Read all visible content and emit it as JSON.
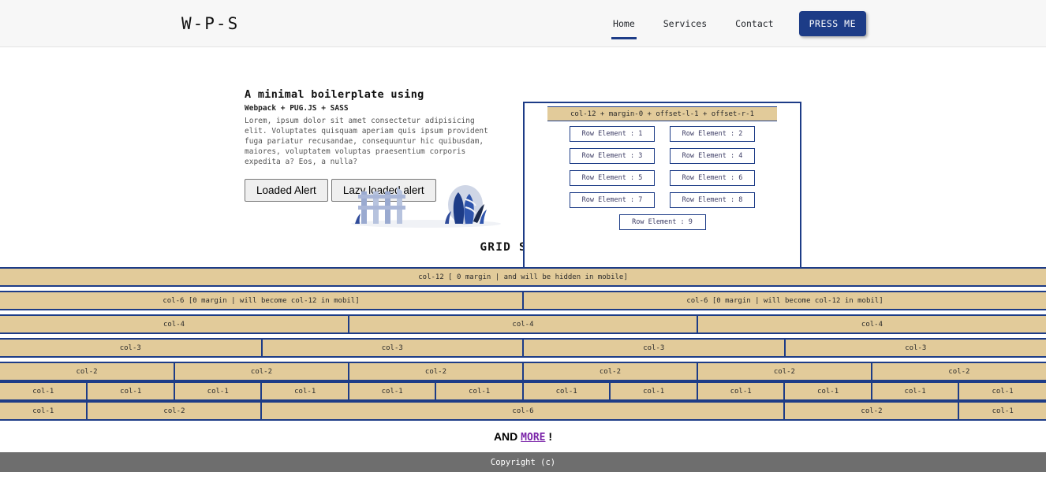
{
  "header": {
    "brand": "W-P-S",
    "nav": [
      {
        "label": "Home",
        "active": true
      },
      {
        "label": "Services",
        "active": false
      },
      {
        "label": "Contact",
        "active": false
      }
    ],
    "cta_label": "PRESS ME"
  },
  "hero": {
    "title": "A minimal boilerplate using",
    "subtitle": "Webpack + PUG.JS + SASS",
    "body": "Lorem, ipsum dolor sit amet consectetur adipisicing elit. Voluptates quisquam aperiam quis ipsum provident fuga pariatur recusandae, consequuntur hic quibusdam, maiores, voluptatem voluptas praesentium corporis expedita a? Eos, a nulla?",
    "button_primary": "Loaded Alert",
    "button_secondary": "Lazy loaded alert"
  },
  "panel": {
    "header_label": "col-12 + margin-0 + offset-l-1 + offset-r-1",
    "rows": [
      [
        "Row Element : 1",
        "Row Element : 2"
      ],
      [
        "Row Element : 3",
        "Row Element : 4"
      ],
      [
        "Row Element : 5",
        "Row Element : 6"
      ],
      [
        "Row Element : 7",
        "Row Element : 8"
      ]
    ],
    "last_row": "Row Element : 9"
  },
  "grid": {
    "heading": "GRID SYSTEM",
    "rows": [
      {
        "cells": [
          {
            "span": 12,
            "label": "col-12 [ 0 margin | and will be hidden in mobile]"
          }
        ]
      },
      {
        "cells": [
          {
            "span": 6,
            "label": "col-6 [0 margin | will become col-12 in mobil]"
          },
          {
            "span": 6,
            "label": "col-6 [0 margin | will become col-12 in mobil]"
          }
        ]
      },
      {
        "cells": [
          {
            "span": 4,
            "label": "col-4"
          },
          {
            "span": 4,
            "label": "col-4"
          },
          {
            "span": 4,
            "label": "col-4"
          }
        ]
      },
      {
        "cells": [
          {
            "span": 3,
            "label": "col-3"
          },
          {
            "span": 3,
            "label": "col-3"
          },
          {
            "span": 3,
            "label": "col-3"
          },
          {
            "span": 3,
            "label": "col-3"
          }
        ]
      },
      {
        "cells": [
          {
            "span": 2,
            "label": "col-2"
          },
          {
            "span": 2,
            "label": "col-2"
          },
          {
            "span": 2,
            "label": "col-2"
          },
          {
            "span": 2,
            "label": "col-2"
          },
          {
            "span": 2,
            "label": "col-2"
          },
          {
            "span": 2,
            "label": "col-2"
          }
        ]
      },
      {
        "cells": [
          {
            "span": 1,
            "label": "col-1"
          },
          {
            "span": 1,
            "label": "col-1"
          },
          {
            "span": 1,
            "label": "col-1"
          },
          {
            "span": 1,
            "label": "col-1"
          },
          {
            "span": 1,
            "label": "col-1"
          },
          {
            "span": 1,
            "label": "col-1"
          },
          {
            "span": 1,
            "label": "col-1"
          },
          {
            "span": 1,
            "label": "col-1"
          },
          {
            "span": 1,
            "label": "col-1"
          },
          {
            "span": 1,
            "label": "col-1"
          },
          {
            "span": 1,
            "label": "col-1"
          },
          {
            "span": 1,
            "label": "col-1"
          }
        ]
      },
      {
        "cells": [
          {
            "span": 1,
            "label": "col-1"
          },
          {
            "span": 2,
            "label": "col-2"
          },
          {
            "span": 6,
            "label": "col-6"
          },
          {
            "span": 2,
            "label": "col-2"
          },
          {
            "span": 1,
            "label": "col-1"
          }
        ]
      }
    ]
  },
  "more": {
    "prefix": "AND",
    "link": "MORE",
    "suffix": "!"
  },
  "footer": {
    "text": "Copyright (c)"
  },
  "colors": {
    "accent_blue": "#1d3c87",
    "cell_tan": "#e2cb9a",
    "footer_gray": "#6e6e6e",
    "link_purple": "#7a24a8",
    "header_bg": "#f7f7f7"
  }
}
